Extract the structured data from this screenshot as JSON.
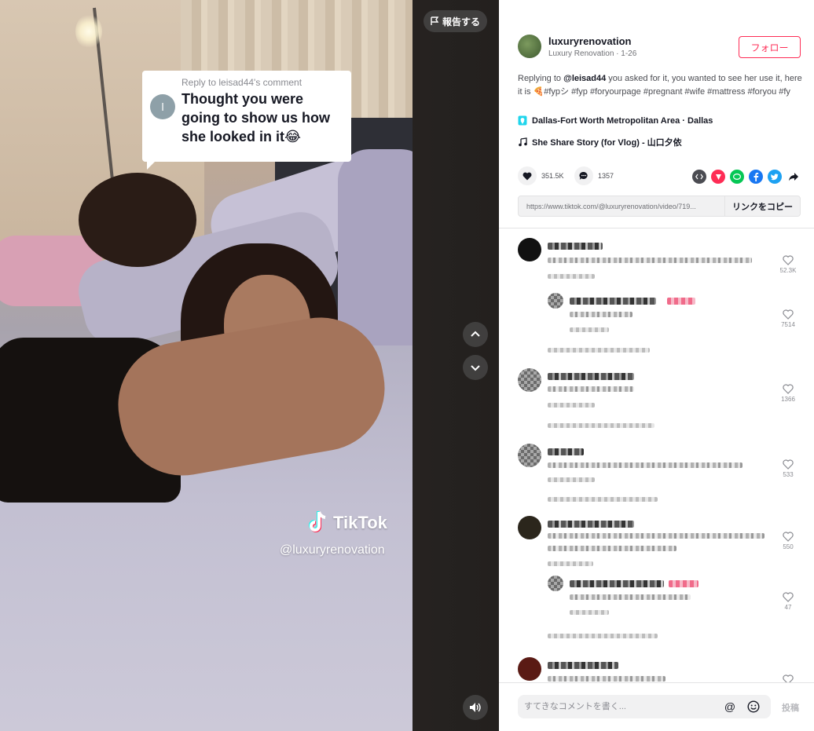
{
  "video": {
    "reply_card": {
      "header": "Reply to leisad44's comment",
      "avatar_initial": "l",
      "text": "Thought you were going to show us how she looked in it😂"
    },
    "watermark": {
      "brand": "TikTok",
      "handle": "@luxuryrenovation"
    },
    "report_label": "報告する"
  },
  "author": {
    "username": "luxuryrenovation",
    "display_name": "Luxury Renovation",
    "date": "1-26",
    "follow_label": "フォロー"
  },
  "caption": {
    "prefix": "Replying to ",
    "mention": "@leisad44",
    "body": " you asked for it, you wanted to see her use it, here it is 🍕#fypシ #fyp #foryourpage #pregnant #wife #mattress #foryou #fy"
  },
  "location": "Dallas-Fort Worth Metropolitan Area · Dallas",
  "music": "She Share Story (for Vlog) - 山口夕依",
  "stats": {
    "likes": "351.5K",
    "comments": "1357"
  },
  "share_icons": [
    "embed-icon",
    "send-to-friends-icon",
    "line-icon",
    "facebook-icon",
    "twitter-icon",
    "share-arrow-icon"
  ],
  "link": {
    "url": "https://www.tiktok.com/@luxuryrenovation/video/719...",
    "copy_label": "リンクをコピー"
  },
  "comments": [
    {
      "likes": "52.3K"
    },
    {
      "likes": "7514"
    },
    {
      "likes": "1366"
    },
    {
      "likes": "533"
    },
    {
      "likes": "550"
    },
    {
      "likes": "47"
    }
  ],
  "comment_bar": {
    "placeholder": "すてきなコメントを書く...",
    "post_label": "投稿"
  },
  "colors": {
    "accent": "#fe2c55",
    "twitter": "#1da1f2",
    "facebook": "#1877f2",
    "line": "#06c755",
    "send": "#fe2c55",
    "embed": "#4b4c52"
  }
}
